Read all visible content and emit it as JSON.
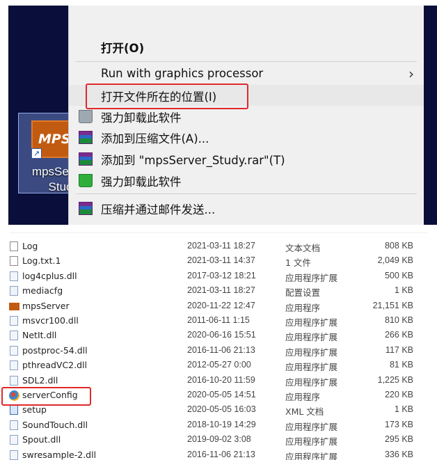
{
  "desktop": {
    "icon": {
      "logo_text": "MPS",
      "label_line1": "mpsServ",
      "label_line2": "Study"
    }
  },
  "context_menu": {
    "items": [
      {
        "label": "打开(O)",
        "icon": "none",
        "bold": true
      },
      {
        "label": "Run with graphics processor",
        "icon": "none",
        "has_submenu": true
      },
      {
        "label": "打开文件所在的位置(I)",
        "icon": "none",
        "highlighted": true
      },
      {
        "label": "强力卸载此软件",
        "icon": "trash-icon"
      },
      {
        "label": "添加到压缩文件(A)...",
        "icon": "winrar-icon"
      },
      {
        "label": "添加到 \"mpsServer_Study.rar\"(T)",
        "icon": "winrar-icon"
      },
      {
        "label": "强力卸载此软件",
        "icon": "green-trash-icon"
      },
      {
        "label": "压缩并通过邮件发送...",
        "icon": "winrar-icon"
      }
    ],
    "submenu_arrow": "›"
  },
  "file_list": {
    "rows": [
      {
        "name": "Log",
        "date": "2021-03-11 18:27",
        "type": "文本文档",
        "size": "808 KB",
        "icon": "text-file-icon"
      },
      {
        "name": "Log.txt.1",
        "date": "2021-03-11 14:37",
        "type": "1 文件",
        "size": "2,049 KB",
        "icon": "file-icon"
      },
      {
        "name": "log4cplus.dll",
        "date": "2017-03-12 18:21",
        "type": "应用程序扩展",
        "size": "500 KB",
        "icon": "dll-icon"
      },
      {
        "name": "mediacfg",
        "date": "2021-03-11 18:27",
        "type": "配置设置",
        "size": "1 KB",
        "icon": "config-icon"
      },
      {
        "name": "mpsServer",
        "date": "2020-11-22 12:47",
        "type": "应用程序",
        "size": "21,151 KB",
        "icon": "mps-app-icon"
      },
      {
        "name": "msvcr100.dll",
        "date": "2011-06-11 1:15",
        "type": "应用程序扩展",
        "size": "810 KB",
        "icon": "dll-icon"
      },
      {
        "name": "NetIt.dll",
        "date": "2020-06-16 15:51",
        "type": "应用程序扩展",
        "size": "266 KB",
        "icon": "dll-icon"
      },
      {
        "name": "postproc-54.dll",
        "date": "2016-11-06 21:13",
        "type": "应用程序扩展",
        "size": "117 KB",
        "icon": "dll-icon"
      },
      {
        "name": "pthreadVC2.dll",
        "date": "2012-05-27 0:00",
        "type": "应用程序扩展",
        "size": "81 KB",
        "icon": "dll-icon"
      },
      {
        "name": "SDL2.dll",
        "date": "2016-10-20 11:59",
        "type": "应用程序扩展",
        "size": "1,225 KB",
        "icon": "dll-icon"
      },
      {
        "name": "serverConfig",
        "date": "2020-05-05 14:51",
        "type": "应用程序",
        "size": "220 KB",
        "icon": "server-config-app-icon",
        "highlighted": true
      },
      {
        "name": "setup",
        "date": "2020-05-05 16:03",
        "type": "XML 文档",
        "size": "1 KB",
        "icon": "xml-file-icon"
      },
      {
        "name": "SoundTouch.dll",
        "date": "2018-10-19 14:29",
        "type": "应用程序扩展",
        "size": "173 KB",
        "icon": "dll-icon"
      },
      {
        "name": "Spout.dll",
        "date": "2019-09-02 3:08",
        "type": "应用程序扩展",
        "size": "295 KB",
        "icon": "dll-icon"
      },
      {
        "name": "swresample-2.dll",
        "date": "2016-11-06 21:13",
        "type": "应用程序扩展",
        "size": "336 KB",
        "icon": "dll-icon"
      }
    ]
  },
  "colors": {
    "desktop_bg": "#0a0e3a",
    "menu_bg": "#f0f0f0",
    "highlight_box": "#e0282a"
  }
}
